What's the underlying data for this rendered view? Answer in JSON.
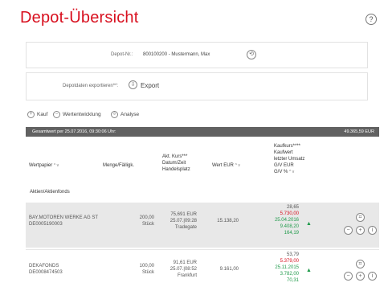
{
  "page_title": "Depot-Übersicht",
  "help_label": "?",
  "depot": {
    "label": "Depot-Nr.:",
    "value": "800100200 - Mustermann, Max",
    "switch_symbol": "⟲"
  },
  "export": {
    "label": "Depotdaten exportieren**:",
    "button_label": "Export",
    "button_symbol": "⇩"
  },
  "actions": [
    {
      "symbol": "+",
      "label": "Kauf"
    },
    {
      "symbol": "−",
      "label": "Wertentwicklung"
    },
    {
      "symbol": "⇩",
      "label": "Analyse"
    }
  ],
  "total": {
    "label": "Gesamtwert per 25.07.2016, 09:30:06 Uhr:",
    "value": "49.365,59 EUR"
  },
  "columns": {
    "wertpapier": "Wertpapier",
    "menge": "Menge/Fälligk.",
    "kurs": [
      "Akt. Kurs***",
      "Datum/Zeit",
      "Handelsplatz"
    ],
    "wert": "Wert EUR",
    "kaufkurs": [
      "Kaufkurs****",
      "Kaufwert",
      "letzter Umsatz",
      "G/V EUR",
      "G/V %"
    ],
    "sort_symbols": "^ v"
  },
  "section_label": "Aktien/Aktienfonds",
  "rows": [
    {
      "name": "BAY.MOTOREN WERKE AG ST",
      "isin": "DE0005190003",
      "menge": "200,00",
      "unit": "Stück",
      "kurs": "75,691 EUR",
      "zeit": "25.07.|09:28",
      "platz": "Tradegate",
      "wert": "15.138,20",
      "kaufkurs": "28,65",
      "kaufwert": "5.730,00",
      "umsatz": "25.04.2016",
      "gv_eur": "9.408,20",
      "gv_pct": "164,19",
      "trend": "▲"
    },
    {
      "name": "DEKAFONDS",
      "isin": "DE0008474503",
      "menge": "100,00",
      "unit": "Stück",
      "kurs": "91,61 EUR",
      "zeit": "25.07.|08:52",
      "platz": "Frankfurt",
      "wert": "9.161,00",
      "kaufkurs": "53,79",
      "kaufwert": "5.379,00",
      "umsatz": "25.11.2015",
      "gv_eur": "3.782,00",
      "gv_pct": "70,31",
      "trend": "▲"
    }
  ],
  "row_buttons": {
    "chart": "⌗",
    "minus": "−",
    "plus": "+",
    "info": "i"
  }
}
